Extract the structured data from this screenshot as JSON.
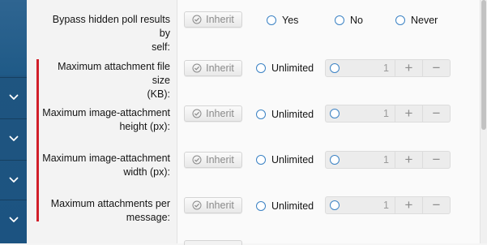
{
  "colors": {
    "sidebar": "#1c5381",
    "required_marker": "#d11f2a",
    "radio": "#3b82c4"
  },
  "sidebar": {
    "chevrons": [
      "chevron-down-icon",
      "chevron-down-icon",
      "chevron-down-icon",
      "chevron-down-icon"
    ]
  },
  "rows": [
    {
      "label_lines": [
        "Bypass hidden poll results by",
        "self:"
      ],
      "inherit": "Inherit",
      "options": [
        "Yes",
        "No",
        "Never"
      ]
    },
    {
      "label_lines": [
        "Maximum attachment file size",
        "(KB):"
      ],
      "inherit": "Inherit",
      "unlimited": "Unlimited",
      "value": "1"
    },
    {
      "label_lines": [
        "Maximum image-attachment",
        "height (px):"
      ],
      "inherit": "Inherit",
      "unlimited": "Unlimited",
      "value": "1"
    },
    {
      "label_lines": [
        "Maximum image-attachment",
        "width (px):"
      ],
      "inherit": "Inherit",
      "unlimited": "Unlimited",
      "value": "1"
    },
    {
      "label_lines": [
        "Maximum attachments per",
        "message:"
      ],
      "inherit": "Inherit",
      "unlimited": "Unlimited",
      "value": "1"
    }
  ],
  "stepper": {
    "plus": "+",
    "minus": "−"
  }
}
